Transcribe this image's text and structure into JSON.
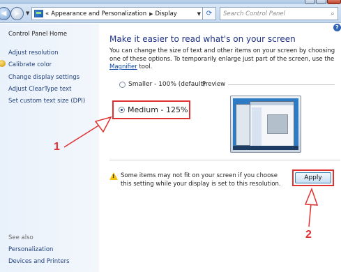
{
  "address_bar": {
    "overflow_glyph": "«",
    "breadcrumb": [
      "Appearance and Personalization",
      "Display"
    ],
    "search_placeholder": "Search Control Panel"
  },
  "sidebar": {
    "home": "Control Panel Home",
    "links": [
      "Adjust resolution",
      "Calibrate color",
      "Change display settings",
      "Adjust ClearType text",
      "Set custom text size (DPI)"
    ],
    "see_also_label": "See also",
    "see_also": [
      "Personalization",
      "Devices and Printers"
    ]
  },
  "main": {
    "heading": "Make it easier to read what's on your screen",
    "description_pre": "You can change the size of text and other items on your screen by choosing one of these options. To temporarily enlarge just part of the screen, use the ",
    "description_link": "Magnifier",
    "description_post": " tool.",
    "options": [
      {
        "label": "Smaller - 100% (default)",
        "selected": false
      },
      {
        "label": "Medium - 125%",
        "selected": true
      }
    ],
    "preview_label": "Preview",
    "warning_text": "Some items may not fit on your screen if you choose this setting while your display is set to this resolution.",
    "apply_label": "Apply"
  },
  "annotations": {
    "marker_1": "1",
    "marker_2": "2",
    "color": "#e03030"
  },
  "icons": [
    "back-icon",
    "forward-icon",
    "control-panel-icon",
    "refresh-icon",
    "search-icon",
    "help-icon",
    "calibrate-color-icon",
    "warning-icon"
  ]
}
